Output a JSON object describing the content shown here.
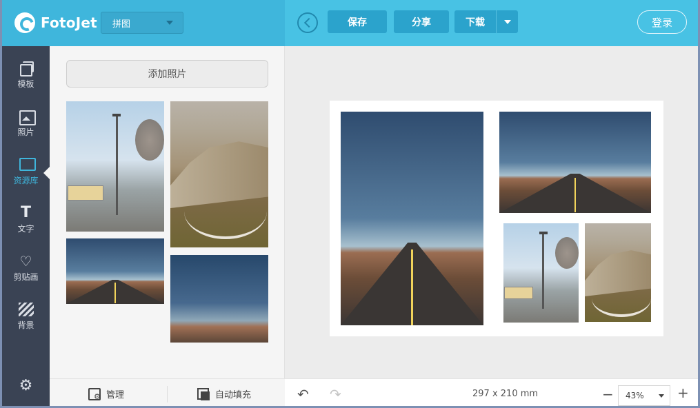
{
  "app": {
    "name": "FotoJet"
  },
  "header": {
    "mode_select": "拼图",
    "save_label": "保存",
    "share_label": "分享",
    "download_label": "下载",
    "login_label": "登录"
  },
  "rail": {
    "items": [
      {
        "label": "模板",
        "icon": "template-icon"
      },
      {
        "label": "照片",
        "icon": "photo-icon"
      },
      {
        "label": "资源库",
        "icon": "monitor-icon",
        "active": true
      },
      {
        "label": "文字",
        "icon": "text-icon"
      },
      {
        "label": "剪贴画",
        "icon": "heart-icon"
      },
      {
        "label": "背景",
        "icon": "stripes-icon"
      }
    ],
    "settings_icon": "gear-icon"
  },
  "panel": {
    "add_photo_label": "添加照片",
    "manage_label": "管理",
    "autofill_label": "自动填充"
  },
  "canvas": {
    "size_label": "297 x 210 mm",
    "zoom_value": "43%"
  },
  "colors": {
    "header_left": "#3fb6dc",
    "header_right": "#48c2e4",
    "rail": "#3a4354",
    "accent": "#3fb6dc"
  }
}
